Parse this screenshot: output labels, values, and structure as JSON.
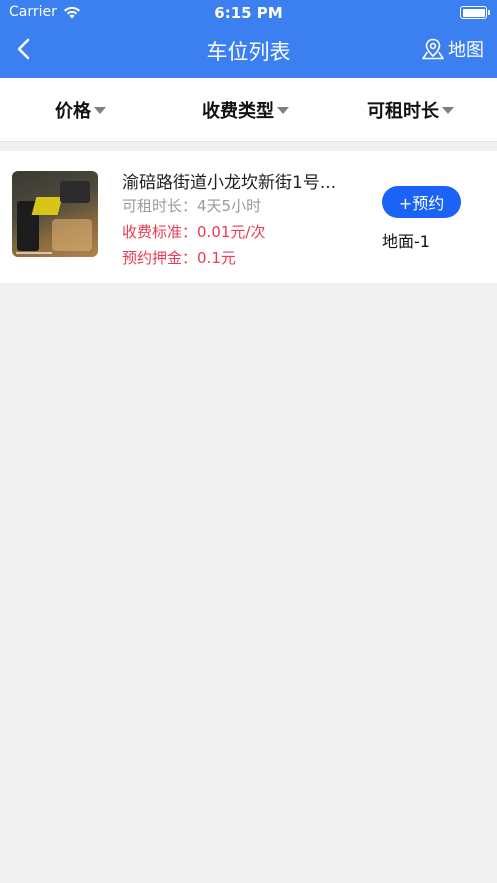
{
  "status_bar": {
    "carrier": "Carrier",
    "time": "6:15 PM"
  },
  "nav": {
    "title": "车位列表",
    "map_label": "地图"
  },
  "filters": [
    {
      "label": "价格"
    },
    {
      "label": "收费类型"
    },
    {
      "label": "可租时长"
    }
  ],
  "listings": [
    {
      "address": "渝碚路街道小龙坎新街1号...",
      "duration_label": "可租时长：",
      "duration_value": "4天5小时",
      "fee_label": "收费标准：",
      "fee_value": "0.01元/次",
      "deposit_label": "预约押金：",
      "deposit_value": "0.1元",
      "reserve_label": "+预约",
      "space": "地面-1"
    }
  ],
  "colors": {
    "header": "#3b7ff0",
    "button": "#1a63f6",
    "price_text": "#ec3b54"
  }
}
